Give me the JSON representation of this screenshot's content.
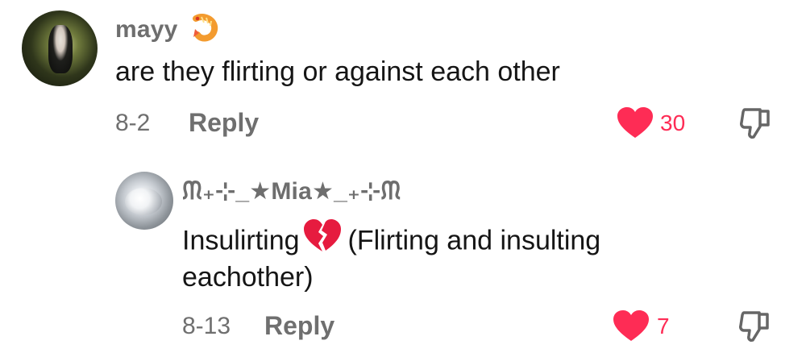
{
  "comments": [
    {
      "username": "mayy",
      "username_emoji": "🍤",
      "text": "are they flirting or against each other",
      "date": "8-2",
      "reply_label": "Reply",
      "likes": "30"
    },
    {
      "username": "ᙏ₊⊹_★Mia★_₊⊹ᙏ",
      "text_part1": "Insulirting",
      "text_emoji": "💔",
      "text_part2": "(Flirting and insulting",
      "text_line2": "eachother)",
      "date": "8-13",
      "reply_label": "Reply",
      "likes": "7"
    }
  ],
  "icons": {
    "like": "heart-icon",
    "dislike": "thumbs-down-icon",
    "broken": "broken-heart-icon",
    "shrimp": "shrimp-icon"
  },
  "colors": {
    "like": "#fe2c55",
    "meta": "#6f6f6f",
    "username": "#6e6e6e",
    "text": "#151515"
  }
}
